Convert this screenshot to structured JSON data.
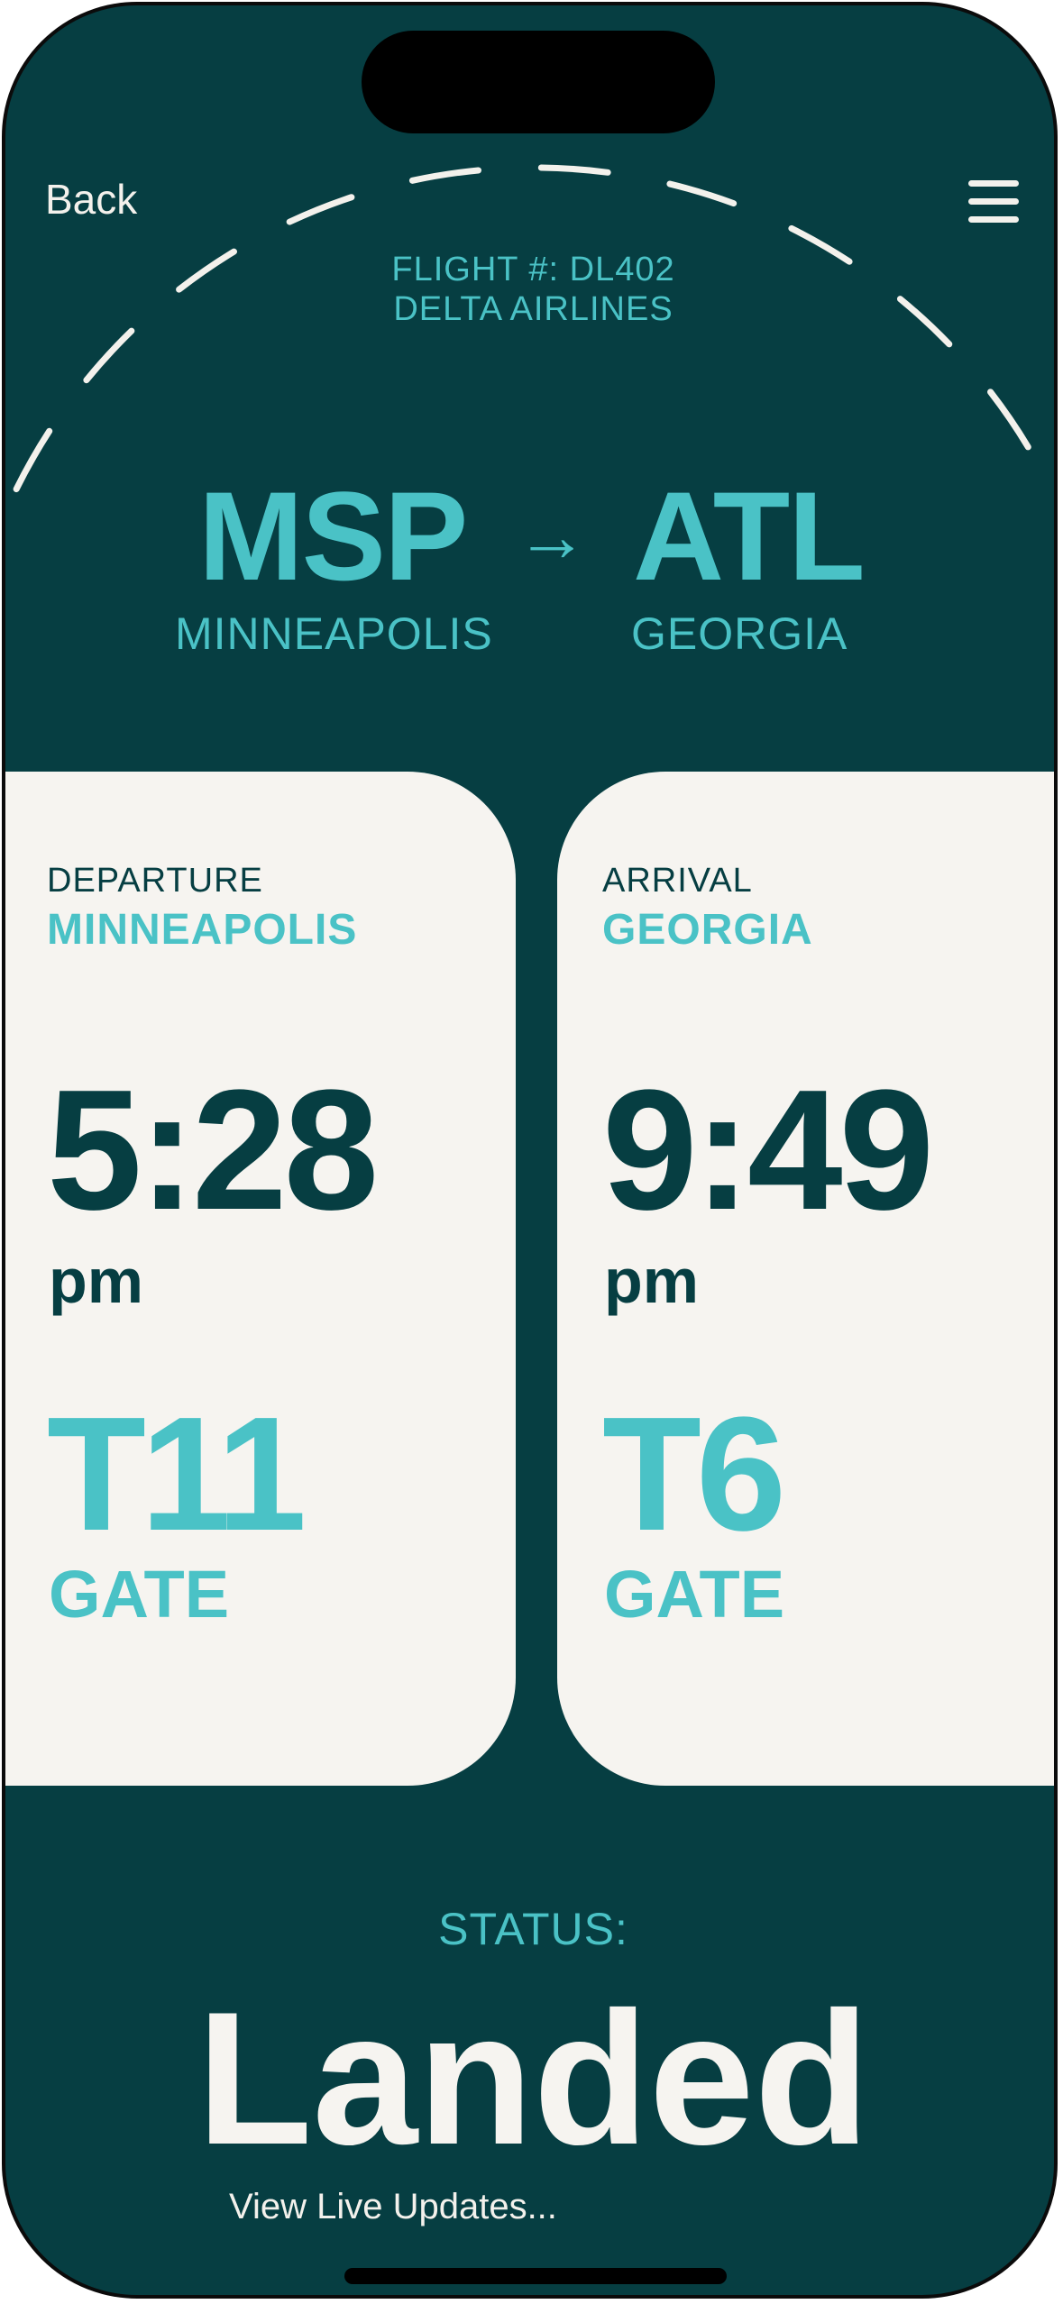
{
  "nav": {
    "back_label": "Back"
  },
  "flight": {
    "number_line": "FLIGHT #: DL402",
    "airline": "DELTA AIRLINES"
  },
  "route": {
    "origin_code": "MSP",
    "origin_city": "MINNEAPOLIS",
    "arrow": "→",
    "destination_code": "ATL",
    "destination_city": "GEORGIA"
  },
  "departure": {
    "label": "DEPARTURE",
    "city": "MINNEAPOLIS",
    "time": "5:28",
    "ampm": "pm",
    "gate": "T11",
    "gate_label": "GATE"
  },
  "arrival": {
    "label": "ARRIVAL",
    "city": "GEORGIA",
    "time": "9:49",
    "ampm": "pm",
    "gate": "T6",
    "gate_label": "GATE"
  },
  "status": {
    "label": "STATUS:",
    "value": "Landed",
    "link": "View Live Updates..."
  },
  "colors": {
    "background": "#063e42",
    "accent": "#4ac2c6",
    "card": "#f6f4f0",
    "light_text": "#f3f1ec"
  },
  "icons": {
    "menu": "hamburger-menu-icon",
    "arrow": "right-arrow-icon"
  }
}
